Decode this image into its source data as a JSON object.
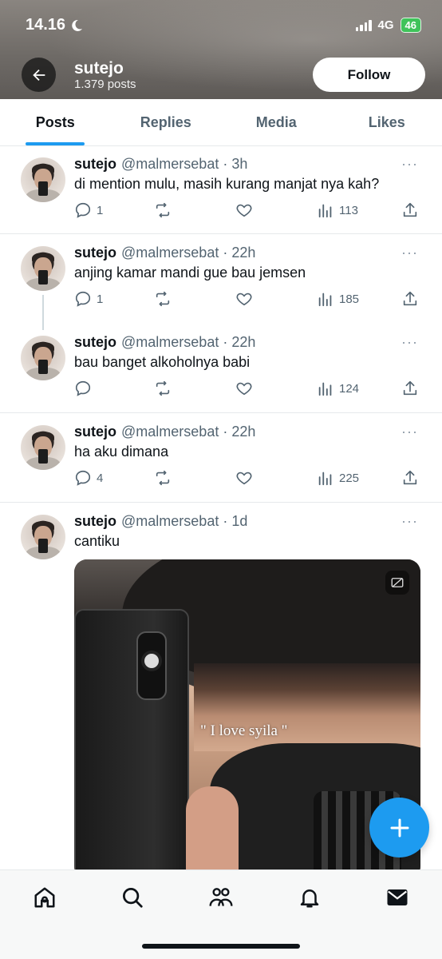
{
  "status_bar": {
    "time": "14.16",
    "network": "4G",
    "battery": "46"
  },
  "profile": {
    "name": "sutejo",
    "posts": "1.379 posts",
    "follow_label": "Follow"
  },
  "tabs": [
    {
      "label": "Posts",
      "active": true
    },
    {
      "label": "Replies",
      "active": false
    },
    {
      "label": "Media",
      "active": false
    },
    {
      "label": "Likes",
      "active": false
    }
  ],
  "tweets": [
    {
      "name": "sutejo",
      "handle": "@malmersebat · 3h",
      "text": "di mention mulu, masih kurang manjat nya kah?",
      "replies": "1",
      "retweets": "",
      "likes": "",
      "views": "113"
    },
    {
      "name": "sutejo",
      "handle": "@malmersebat · 22h",
      "text": "anjing kamar mandi gue bau jemsen",
      "replies": "1",
      "retweets": "",
      "likes": "",
      "views": "185"
    },
    {
      "name": "sutejo",
      "handle": "@malmersebat · 22h",
      "text": "bau banget alkoholnya babi",
      "replies": "",
      "retweets": "",
      "likes": "",
      "views": "124"
    },
    {
      "name": "sutejo",
      "handle": "@malmersebat · 22h",
      "text": "ha aku dimana",
      "replies": "4",
      "retweets": "",
      "likes": "",
      "views": "225"
    },
    {
      "name": "sutejo",
      "handle": "@malmersebat · 1d",
      "text": "cantiku",
      "media_caption": "\" I love syila \""
    }
  ],
  "more_label": "···",
  "colors": {
    "accent": "#1d9bf0",
    "text": "#0f1419",
    "secondary": "#536471"
  },
  "icons": {
    "back": "arrow-left-icon",
    "reply": "comment-icon",
    "retweet": "retweet-icon",
    "like": "heart-icon",
    "views": "analytics-icon",
    "share": "share-icon",
    "compose": "plus-icon",
    "nav": [
      "home-icon",
      "search-icon",
      "communities-icon",
      "bell-icon",
      "mail-icon"
    ]
  }
}
